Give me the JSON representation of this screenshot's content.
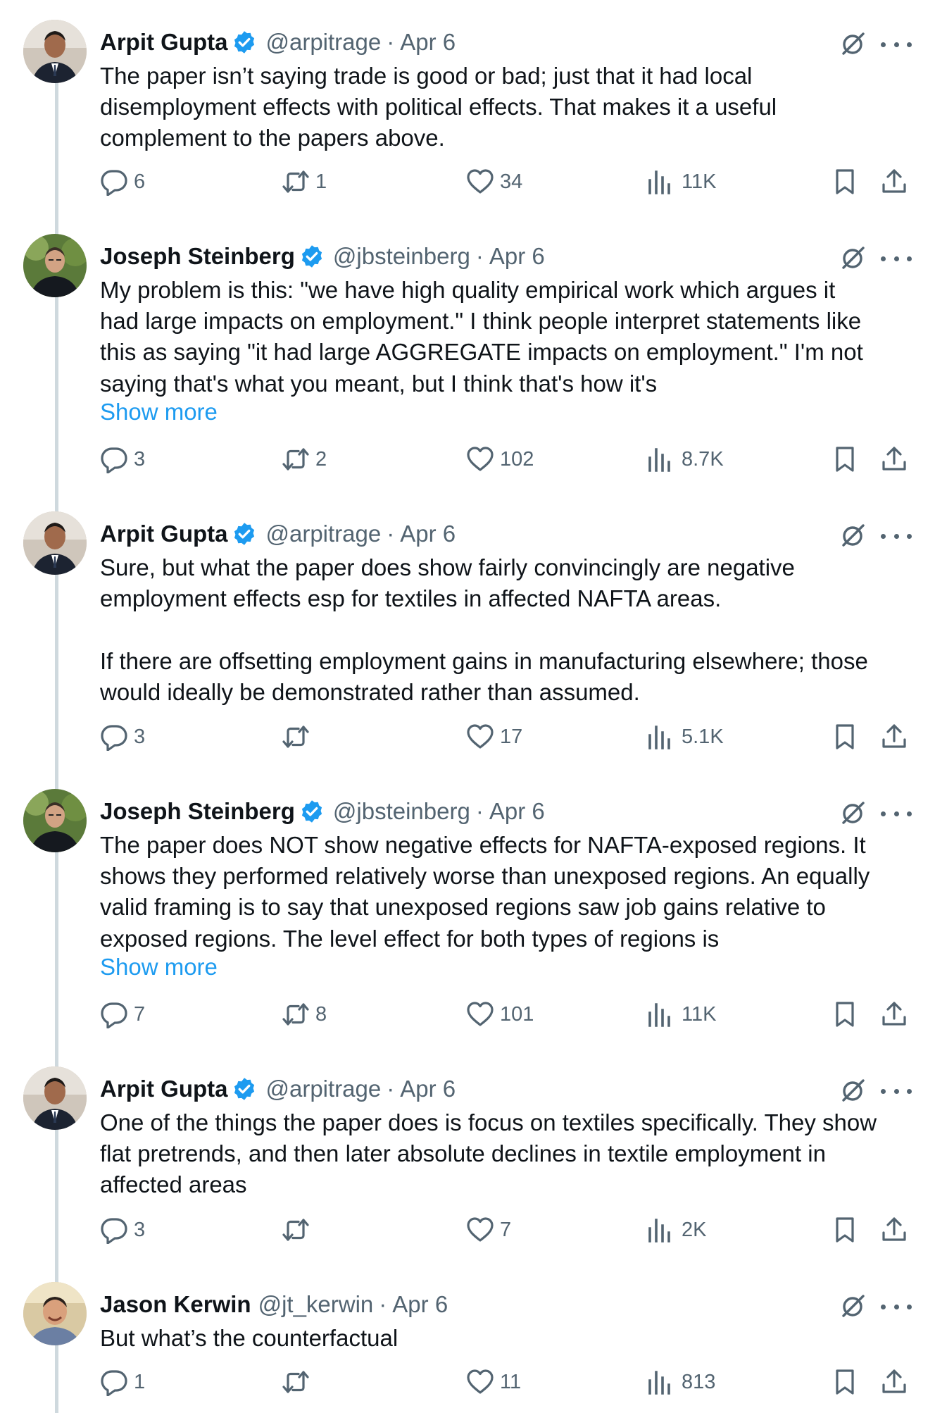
{
  "tweets": [
    {
      "name": "Arpit Gupta",
      "handle": "@arpitrage",
      "separator": "·",
      "date": "Apr 6",
      "verified": true,
      "text": "The paper isn’t saying trade is good or bad; just that it had local\ndisemployment effects with political effects. That makes it a useful\ncomplement to the papers above.",
      "show_more": "",
      "replies": "6",
      "retweets": "1",
      "likes": "34",
      "views": "11K"
    },
    {
      "name": "Joseph Steinberg",
      "handle": "@jbsteinberg",
      "separator": "·",
      "date": "Apr 6",
      "verified": true,
      "text": "My problem is this: \"we have high quality empirical work which argues it\nhad large impacts on employment.\" I think people interpret statements like\nthis as saying \"it had large AGGREGATE impacts on employment.\" I'm not\nsaying that's what you meant, but I think that's how it's",
      "show_more": "Show more",
      "replies": "3",
      "retweets": "2",
      "likes": "102",
      "views": "8.7K"
    },
    {
      "name": "Arpit Gupta",
      "handle": "@arpitrage",
      "separator": "·",
      "date": "Apr 6",
      "verified": true,
      "text": "Sure, but what the paper does show fairly convincingly are negative\nemployment effects esp for textiles in affected NAFTA areas.\n\nIf there are offsetting employment gains in manufacturing elsewhere; those\nwould ideally be demonstrated rather than assumed.",
      "show_more": "",
      "replies": "3",
      "retweets": "",
      "likes": "17",
      "views": "5.1K"
    },
    {
      "name": "Joseph Steinberg",
      "handle": "@jbsteinberg",
      "separator": "·",
      "date": "Apr 6",
      "verified": true,
      "text": "The paper does NOT show negative effects for NAFTA-exposed regions. It\nshows they performed relatively worse than unexposed regions. An equally\nvalid framing is to say that unexposed regions saw job gains relative to\nexposed regions. The level effect for both types of regions is",
      "show_more": "Show more",
      "replies": "7",
      "retweets": "8",
      "likes": "101",
      "views": "11K"
    },
    {
      "name": "Arpit Gupta",
      "handle": "@arpitrage",
      "separator": "·",
      "date": "Apr 6",
      "verified": true,
      "text": "One of the things the paper does is focus on textiles specifically. They show\nflat pretrends, and then later absolute declines in textile employment in\naffected areas",
      "show_more": "",
      "replies": "3",
      "retweets": "",
      "likes": "7",
      "views": "2K"
    },
    {
      "name": "Jason Kerwin",
      "handle": "@jt_kerwin",
      "separator": "·",
      "date": "Apr 6",
      "verified": false,
      "text": "But what’s the counterfactual",
      "show_more": "",
      "replies": "1",
      "retweets": "",
      "likes": "11",
      "views": "813"
    }
  ],
  "icons": {
    "verified": "verified-badge-icon",
    "grok": "grok-icon",
    "more": "more-dots-icon",
    "reply": "reply-icon",
    "retweet": "retweet-icon",
    "like": "heart-icon",
    "views": "views-chart-icon",
    "bookmark": "bookmark-icon",
    "share": "share-icon"
  },
  "colors": {
    "text": "#0f1419",
    "secondary": "#536471",
    "link": "#1d9bf0",
    "verified": "#1d9bf0",
    "thread_line": "#cfd9de"
  }
}
